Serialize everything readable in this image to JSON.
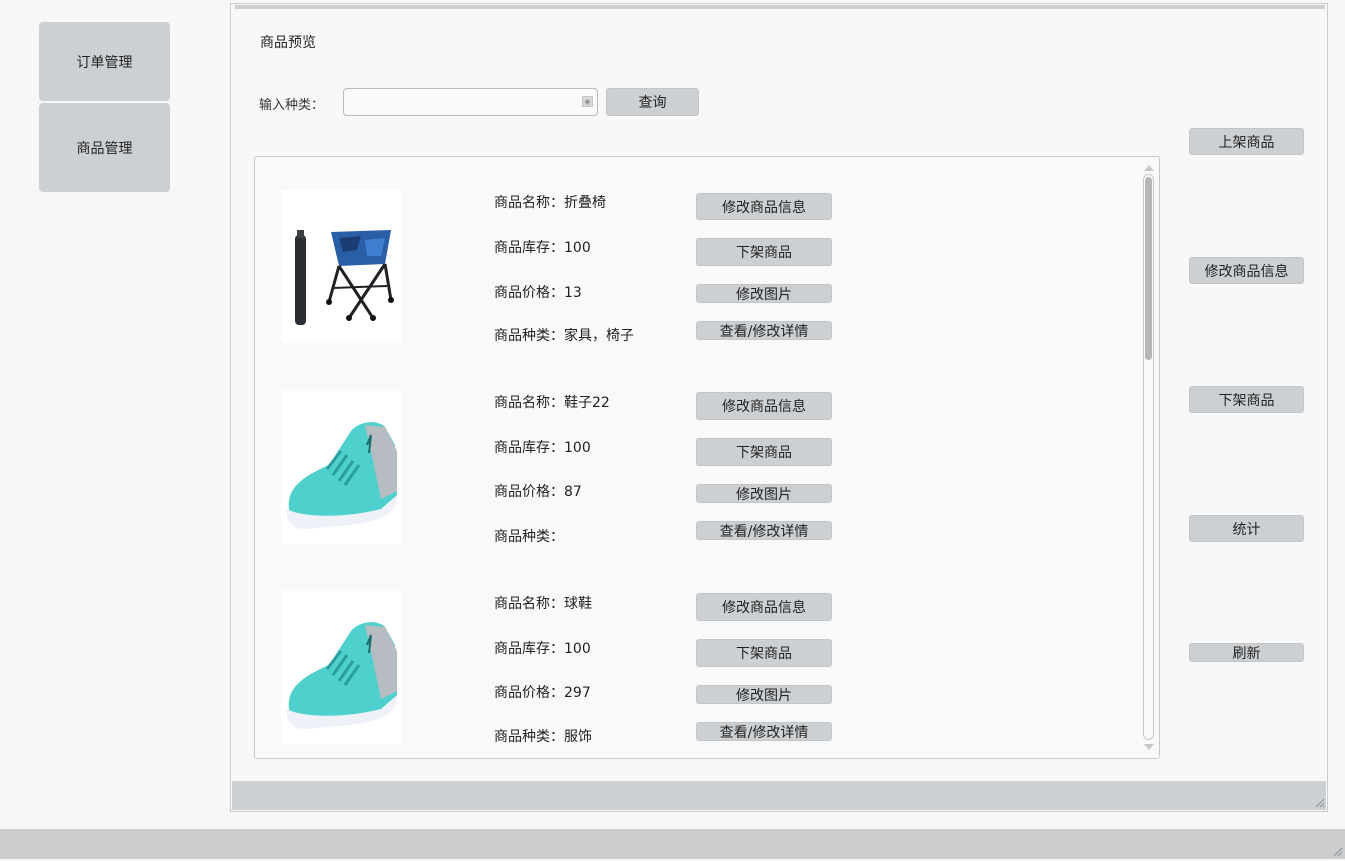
{
  "sidebar": {
    "orders_label": "订单管理",
    "products_label": "商品管理"
  },
  "main": {
    "title": "商品预览",
    "search": {
      "label": "输入种类：",
      "value": "",
      "query_label": "查询"
    },
    "products": [
      {
        "name_text": "商品名称：折叠椅",
        "stock_text": "商品库存：100",
        "price_text": "商品价格：13",
        "category_text": "商品种类：家具，椅子",
        "image": "folding-chair",
        "edit_info_label": "修改商品信息",
        "delist_label": "下架商品",
        "edit_image_label": "修改图片",
        "details_label": "查看/修改详情"
      },
      {
        "name_text": "商品名称：鞋子22",
        "stock_text": "商品库存：100",
        "price_text": "商品价格：87",
        "category_text": "商品种类：",
        "image": "basketball-shoe",
        "edit_info_label": "修改商品信息",
        "delist_label": "下架商品",
        "edit_image_label": "修改图片",
        "details_label": "查看/修改详情"
      },
      {
        "name_text": "商品名称：球鞋",
        "stock_text": "商品库存：100",
        "price_text": "商品价格：297",
        "category_text": "商品种类：服饰",
        "image": "basketball-shoe",
        "edit_info_label": "修改商品信息",
        "delist_label": "下架商品",
        "edit_image_label": "修改图片",
        "details_label": "查看/修改详情"
      }
    ]
  },
  "right_actions": {
    "list_product_label": "上架商品",
    "edit_product_label": "修改商品信息",
    "delist_product_label": "下架商品",
    "stats_label": "统计",
    "refresh_label": "刷新"
  },
  "colors": {
    "button_bg": "#cdd0d3",
    "shoe_teal": "#4fd0cc",
    "chair_blue": "#2a5fa8"
  }
}
